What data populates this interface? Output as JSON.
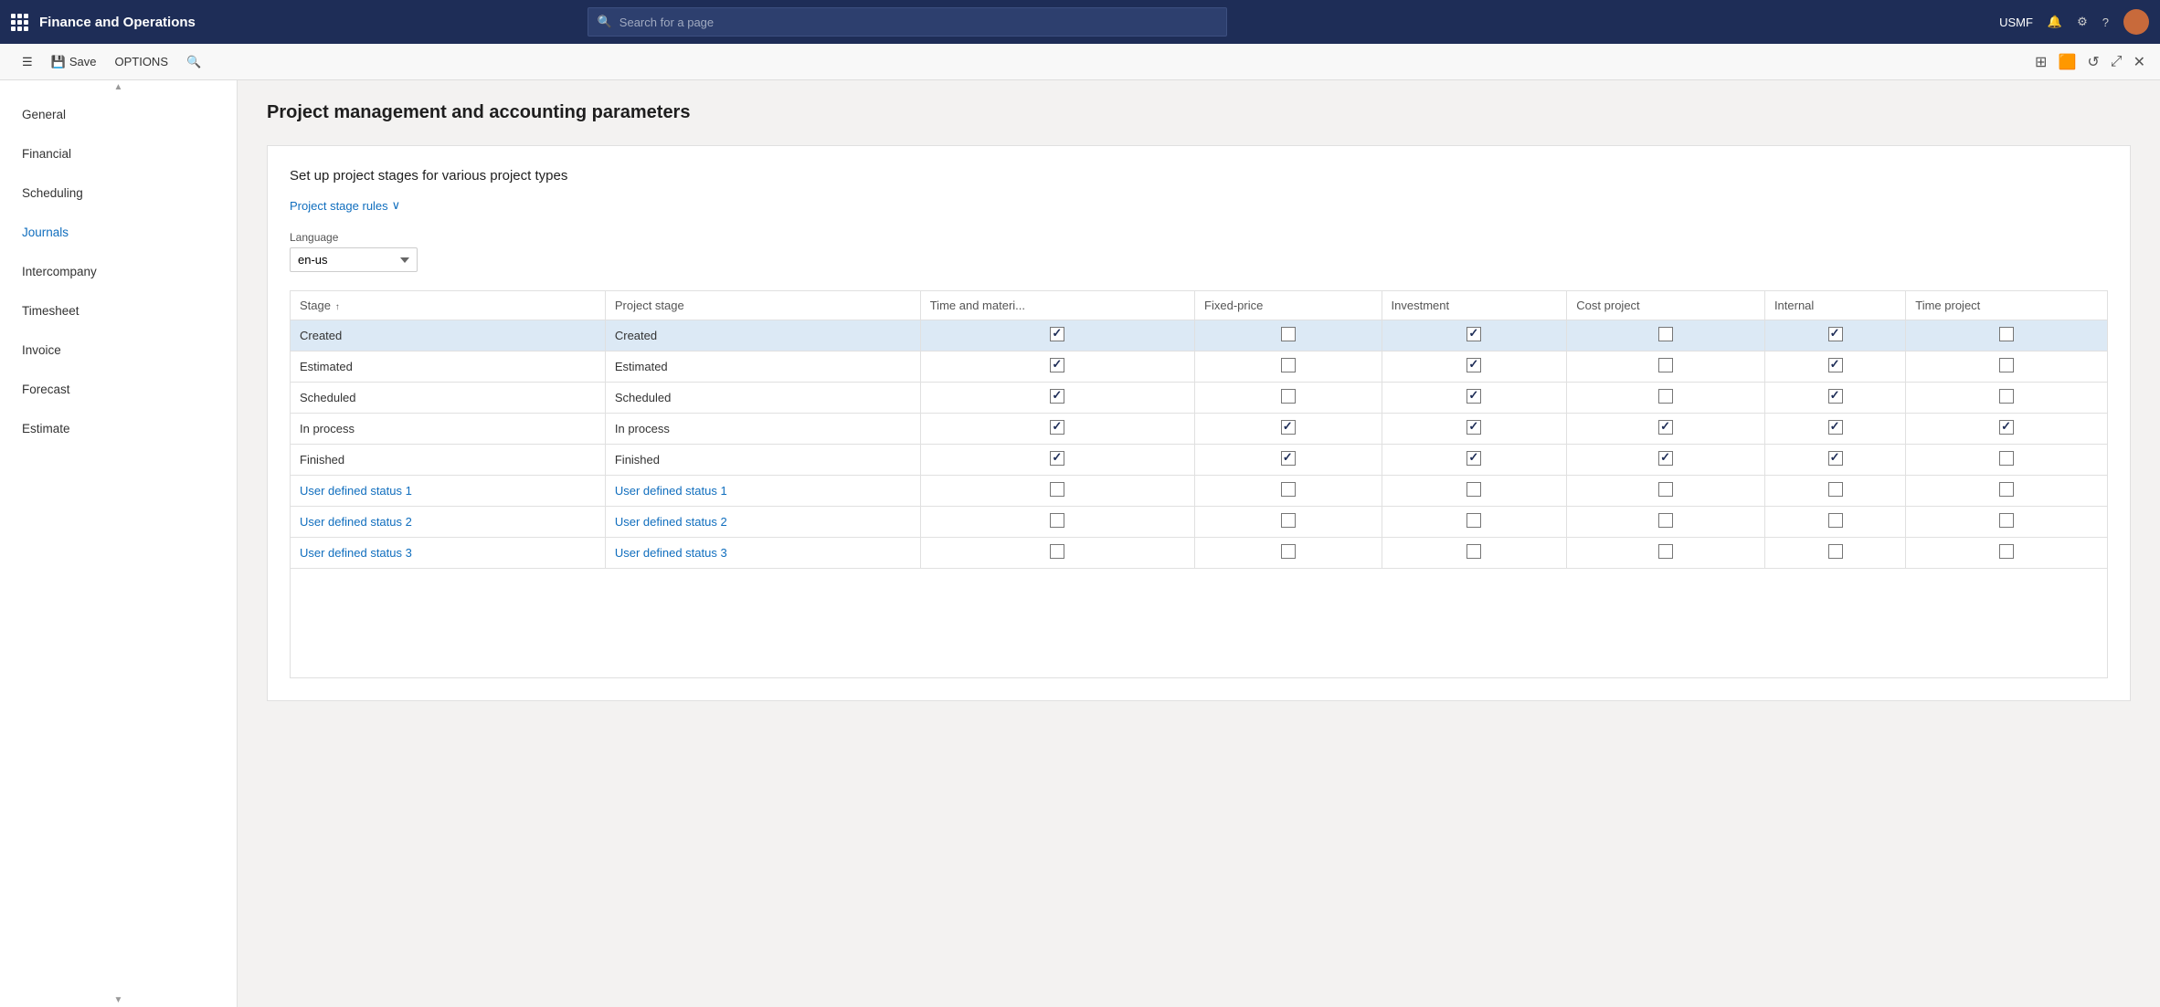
{
  "topbar": {
    "app_title": "Finance and Operations",
    "search_placeholder": "Search for a page",
    "user_label": "USMF"
  },
  "toolbar": {
    "save_label": "Save",
    "options_label": "OPTIONS"
  },
  "page": {
    "title": "Project management and accounting parameters",
    "section_description": "Set up project stages for various project types",
    "stage_rules_link": "Project stage rules",
    "language_label": "Language",
    "language_value": "en-us"
  },
  "left_nav": {
    "items": [
      {
        "id": "general",
        "label": "General",
        "active": false
      },
      {
        "id": "financial",
        "label": "Financial",
        "active": false
      },
      {
        "id": "scheduling",
        "label": "Scheduling",
        "active": false
      },
      {
        "id": "journals",
        "label": "Journals",
        "active": true
      },
      {
        "id": "intercompany",
        "label": "Intercompany",
        "active": false
      },
      {
        "id": "timesheet",
        "label": "Timesheet",
        "active": false
      },
      {
        "id": "invoice",
        "label": "Invoice",
        "active": false
      },
      {
        "id": "forecast",
        "label": "Forecast",
        "active": false
      },
      {
        "id": "estimate",
        "label": "Estimate",
        "active": false
      }
    ]
  },
  "table": {
    "columns": [
      {
        "id": "stage",
        "label": "Stage",
        "sortable": true,
        "sort": "asc"
      },
      {
        "id": "project_stage",
        "label": "Project stage"
      },
      {
        "id": "time_material",
        "label": "Time and materi..."
      },
      {
        "id": "fixed_price",
        "label": "Fixed-price"
      },
      {
        "id": "investment",
        "label": "Investment"
      },
      {
        "id": "cost_project",
        "label": "Cost project"
      },
      {
        "id": "internal",
        "label": "Internal"
      },
      {
        "id": "time_project",
        "label": "Time project"
      }
    ],
    "rows": [
      {
        "stage": "Created",
        "project_stage": "Created",
        "time_material": true,
        "fixed_price": false,
        "investment": true,
        "cost_project": false,
        "internal": true,
        "time_project": false,
        "selected": true,
        "is_link": false
      },
      {
        "stage": "Estimated",
        "project_stage": "Estimated",
        "time_material": true,
        "fixed_price": false,
        "investment": true,
        "cost_project": false,
        "internal": true,
        "time_project": false,
        "selected": false,
        "is_link": false
      },
      {
        "stage": "Scheduled",
        "project_stage": "Scheduled",
        "time_material": true,
        "fixed_price": false,
        "investment": true,
        "cost_project": false,
        "internal": true,
        "time_project": false,
        "selected": false,
        "is_link": false
      },
      {
        "stage": "In process",
        "project_stage": "In process",
        "time_material": true,
        "fixed_price": true,
        "investment": true,
        "cost_project": true,
        "internal": true,
        "time_project": true,
        "selected": false,
        "is_link": false
      },
      {
        "stage": "Finished",
        "project_stage": "Finished",
        "time_material": true,
        "fixed_price": true,
        "investment": true,
        "cost_project": true,
        "internal": true,
        "time_project": false,
        "selected": false,
        "is_link": false
      },
      {
        "stage": "User defined status 1",
        "project_stage": "User defined status 1",
        "time_material": false,
        "fixed_price": false,
        "investment": false,
        "cost_project": false,
        "internal": false,
        "time_project": false,
        "selected": false,
        "is_link": true
      },
      {
        "stage": "User defined status 2",
        "project_stage": "User defined status 2",
        "time_material": false,
        "fixed_price": false,
        "investment": false,
        "cost_project": false,
        "internal": false,
        "time_project": false,
        "selected": false,
        "is_link": true
      },
      {
        "stage": "User defined status 3",
        "project_stage": "User defined status 3",
        "time_material": false,
        "fixed_price": false,
        "investment": false,
        "cost_project": false,
        "internal": false,
        "time_project": false,
        "selected": false,
        "is_link": true
      }
    ]
  }
}
